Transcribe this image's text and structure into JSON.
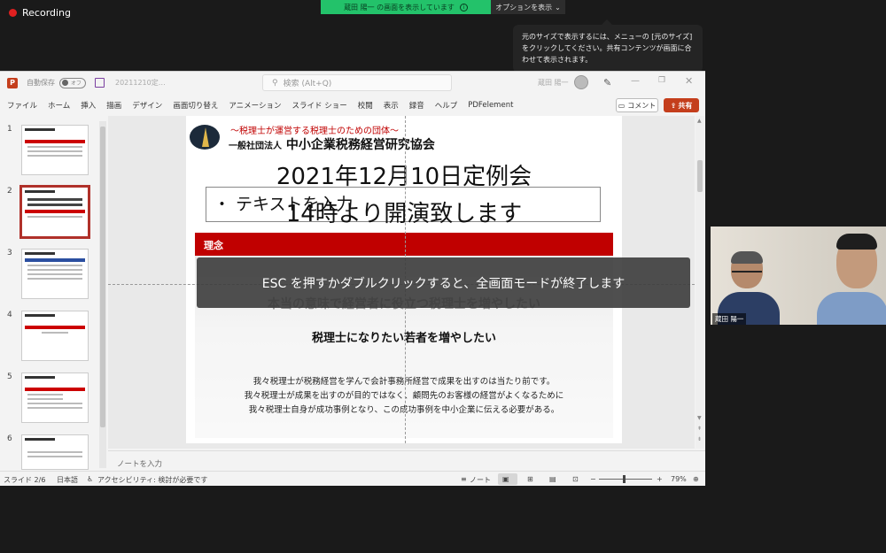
{
  "recording": {
    "label": "Recording"
  },
  "share_banner": {
    "message": "蔵田 陽一 の画面を表示しています",
    "options_label": "オプションを表示"
  },
  "tooltip": {
    "line1": "元のサイズで表示するには、メニューの [元のサイズ]",
    "line2": "をクリックしてください。共有コンテンツが画面に合",
    "line3": "わせて表示されます。"
  },
  "ppt": {
    "app_icon": "P",
    "autosave_label": "自動保存",
    "autosave_state": "オフ",
    "doc_title": "20211210定…",
    "search_placeholder": "検索 (Alt+Q)",
    "user_name": "蔵田 陽一",
    "ribbon_tabs": [
      "ファイル",
      "ホーム",
      "挿入",
      "描画",
      "デザイン",
      "画面切り替え",
      "アニメーション",
      "スライド ショー",
      "校閲",
      "表示",
      "録音",
      "ヘルプ",
      "PDFelement"
    ],
    "comment_label": "コメント",
    "share_label": "共有",
    "thumbnail_numbers": [
      "1",
      "2",
      "3",
      "4",
      "5",
      "6"
    ],
    "notes_placeholder": "ノートを入力",
    "status": {
      "slide_pos": "スライド 2/6",
      "language": "日本語",
      "accessibility": "アクセシビリティ: 検討が必要です",
      "notes_label": "ノート",
      "zoom": "79%"
    }
  },
  "slide": {
    "tagline": "～税理士が運営する税理士のための団体～",
    "org_prefix": "一般社団法人",
    "org_name": "中小企業税務経営研究協会",
    "heading": "2021年12月10日定例会",
    "textbox_placeholder": "・ テキストを入力",
    "subheading": "14時より開演致します",
    "section_label": "理念",
    "faded_line": "本当の意味で経営者に役立つ税理士を増やしたい",
    "main_message": "税理士になりたい若者を増やしたい",
    "body_lines": [
      "我々税理士が税務経営を学んで会計事務所経営で成果を出すのは当たり前です。",
      "我々税理士が成果を出すのが目的ではなく、顧問先のお客様の経営がよくなるために",
      "我々税理士自身が成功事例となり、この成功事例を中小企業に伝える必要がある。"
    ]
  },
  "esc_banner": "ESC を押すかダブルクリックすると、全画面モードが終了します",
  "video": {
    "participant_name": "蔵田 陽一"
  },
  "colors": {
    "accent_red": "#c00000",
    "share_green": "#23c26a",
    "ppt_brand": "#c43e1c"
  }
}
